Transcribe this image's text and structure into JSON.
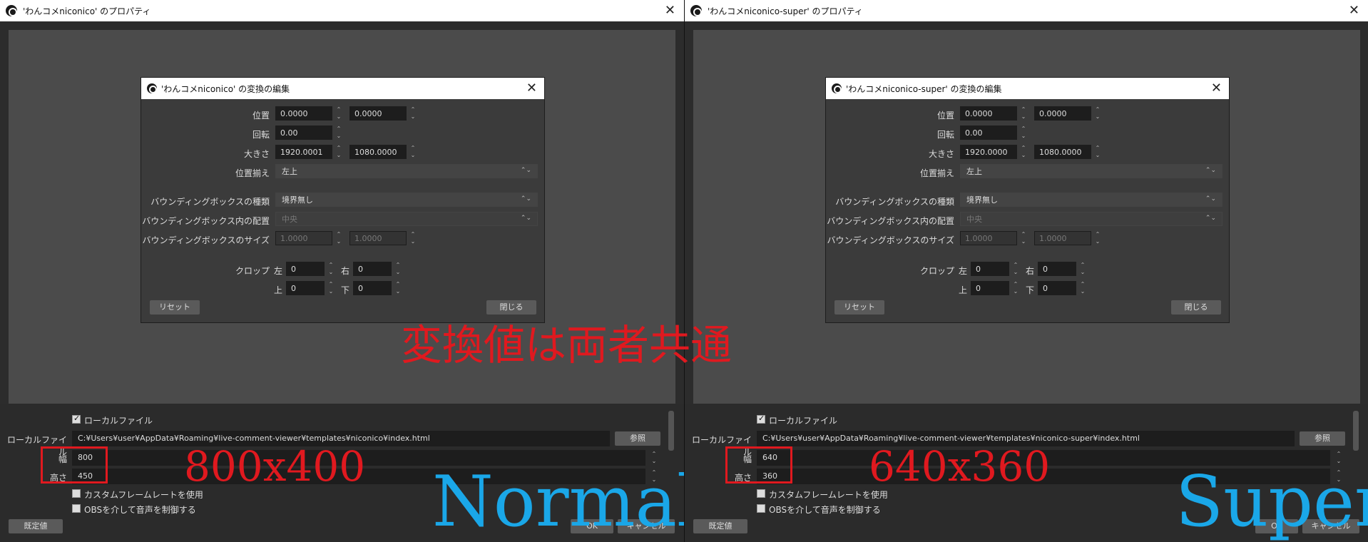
{
  "left": {
    "window_title": "'わんコメniconico' のプロパティ",
    "dialog_title": "'わんコメniconico' の変換の編集",
    "position_x": "0.0000",
    "position_y": "0.0000",
    "rotation": "0.00",
    "size_w": "1920.0001",
    "size_h": "1080.0000",
    "alignment": "左上",
    "bbox_type": "境界無し",
    "bbox_align": "中央",
    "bbox_size_w": "1.0000",
    "bbox_size_h": "1.0000",
    "crop_left": "0",
    "crop_right": "0",
    "crop_top": "0",
    "crop_bottom": "0",
    "local_file_path": "C:¥Users¥user¥AppData¥Roaming¥live-comment-viewer¥templates¥niconico¥index.html",
    "width": "800",
    "height": "450",
    "size_annotation": "800x400",
    "mode_annotation": "Normal"
  },
  "right": {
    "window_title": "'わんコメniconico-super' のプロパティ",
    "dialog_title": "'わんコメniconico-super' の変換の編集",
    "position_x": "0.0000",
    "position_y": "0.0000",
    "rotation": "0.00",
    "size_w": "1920.0000",
    "size_h": "1080.0000",
    "alignment": "左上",
    "bbox_type": "境界無し",
    "bbox_align": "中央",
    "bbox_size_w": "1.0000",
    "bbox_size_h": "1.0000",
    "crop_left": "0",
    "crop_right": "0",
    "crop_top": "0",
    "crop_bottom": "0",
    "local_file_path": "C:¥Users¥user¥AppData¥Roaming¥live-comment-viewer¥templates¥niconico-super¥index.html",
    "width": "640",
    "height": "360",
    "size_annotation": "640x360",
    "mode_annotation": "Super"
  },
  "labels": {
    "position": "位置",
    "rotation": "回転",
    "size": "大きさ",
    "alignment": "位置揃え",
    "bbox_type": "バウンディングボックスの種類",
    "bbox_align": "バウンディングボックス内の配置",
    "bbox_size": "バウンディングボックスのサイズ",
    "crop": "クロップ",
    "crop_left": "左",
    "crop_right": "右",
    "crop_top": "上",
    "crop_bottom": "下",
    "reset": "リセット",
    "close": "閉じる",
    "local_file_checkbox": "ローカルファイル",
    "local_file": "ローカルファイル",
    "browse": "参照",
    "width": "幅",
    "height": "高さ",
    "custom_fps": "カスタムフレームレートを使用",
    "obs_audio": "OBSを介して音声を制御する",
    "defaults": "既定値",
    "ok": "OK",
    "cancel": "キャンセル"
  },
  "shared_annotation": "変換値は両者共通",
  "colors": {
    "annotation_red": "#e0191f",
    "annotation_blue": "#1aa7e8"
  }
}
